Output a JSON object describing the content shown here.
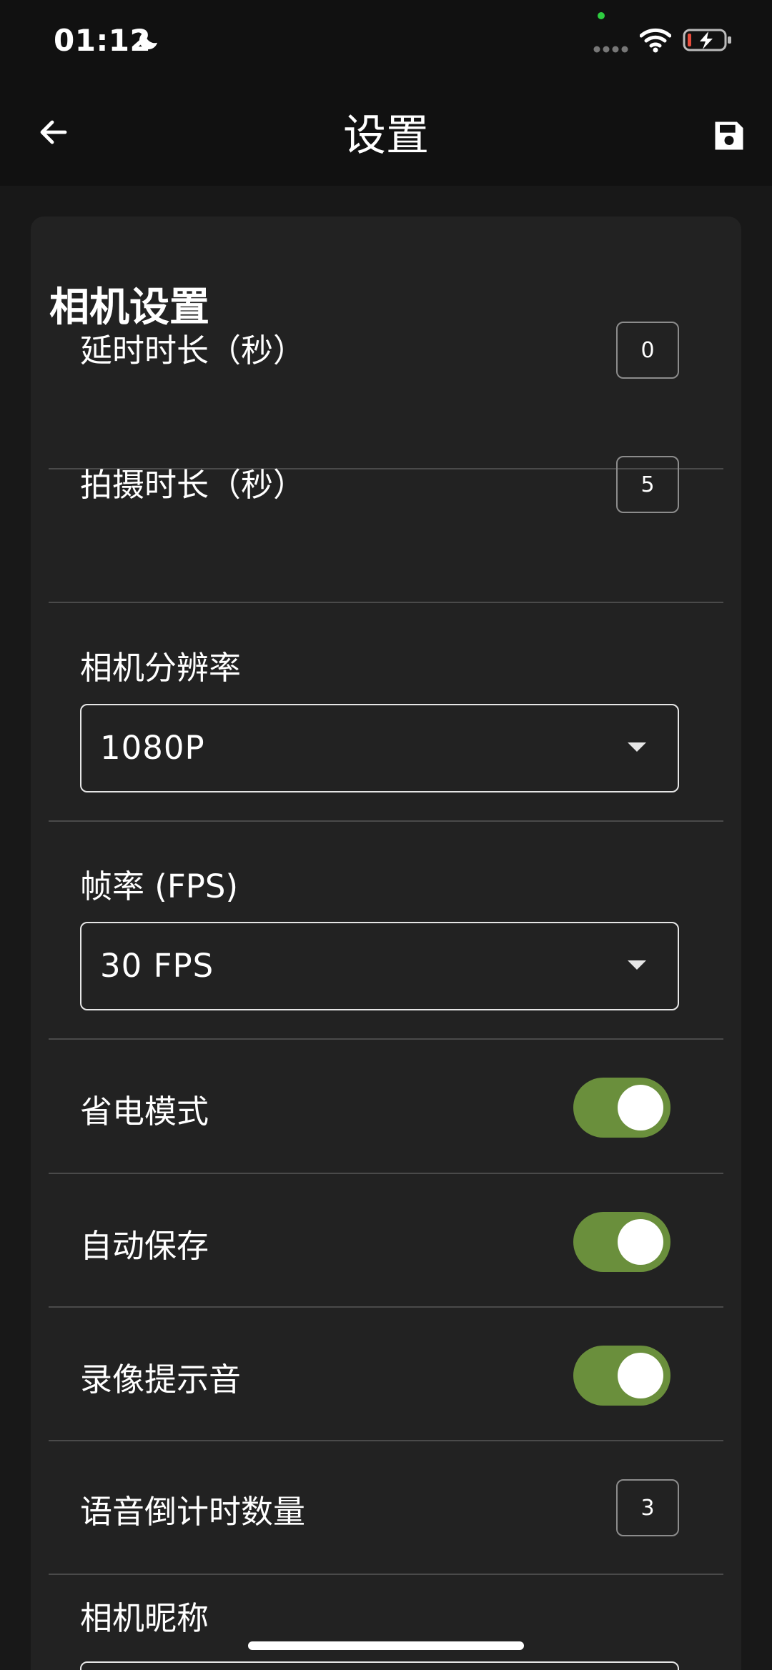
{
  "status_bar": {
    "time": "01:12",
    "icons": [
      "moon-icon",
      "signal-icon",
      "wifi-icon",
      "battery-icon"
    ]
  },
  "app_bar": {
    "title": "设置",
    "back_icon": "arrow-left-icon",
    "save_icon": "floppy-disk-icon"
  },
  "section": {
    "title": "相机设置"
  },
  "settings": {
    "delay": {
      "label": "延时时长（秒）",
      "value": "0"
    },
    "duration": {
      "label": "拍摄时长（秒）",
      "value": "5"
    },
    "resolution": {
      "label": "相机分辨率",
      "value": "1080P"
    },
    "fps": {
      "label": "帧率 (FPS)",
      "value": "30 FPS"
    },
    "power_save": {
      "label": "省电模式",
      "on": true
    },
    "auto_save": {
      "label": "自动保存",
      "on": true
    },
    "record_sound": {
      "label": "录像提示音",
      "on": true
    },
    "countdown": {
      "label": "语音倒计时数量",
      "value": "3"
    },
    "nickname": {
      "label": "相机昵称"
    }
  },
  "colors": {
    "background": "#181818",
    "card": "#222222",
    "toggle_on": "#6a8f3c",
    "divider": "#4a4a4a"
  }
}
